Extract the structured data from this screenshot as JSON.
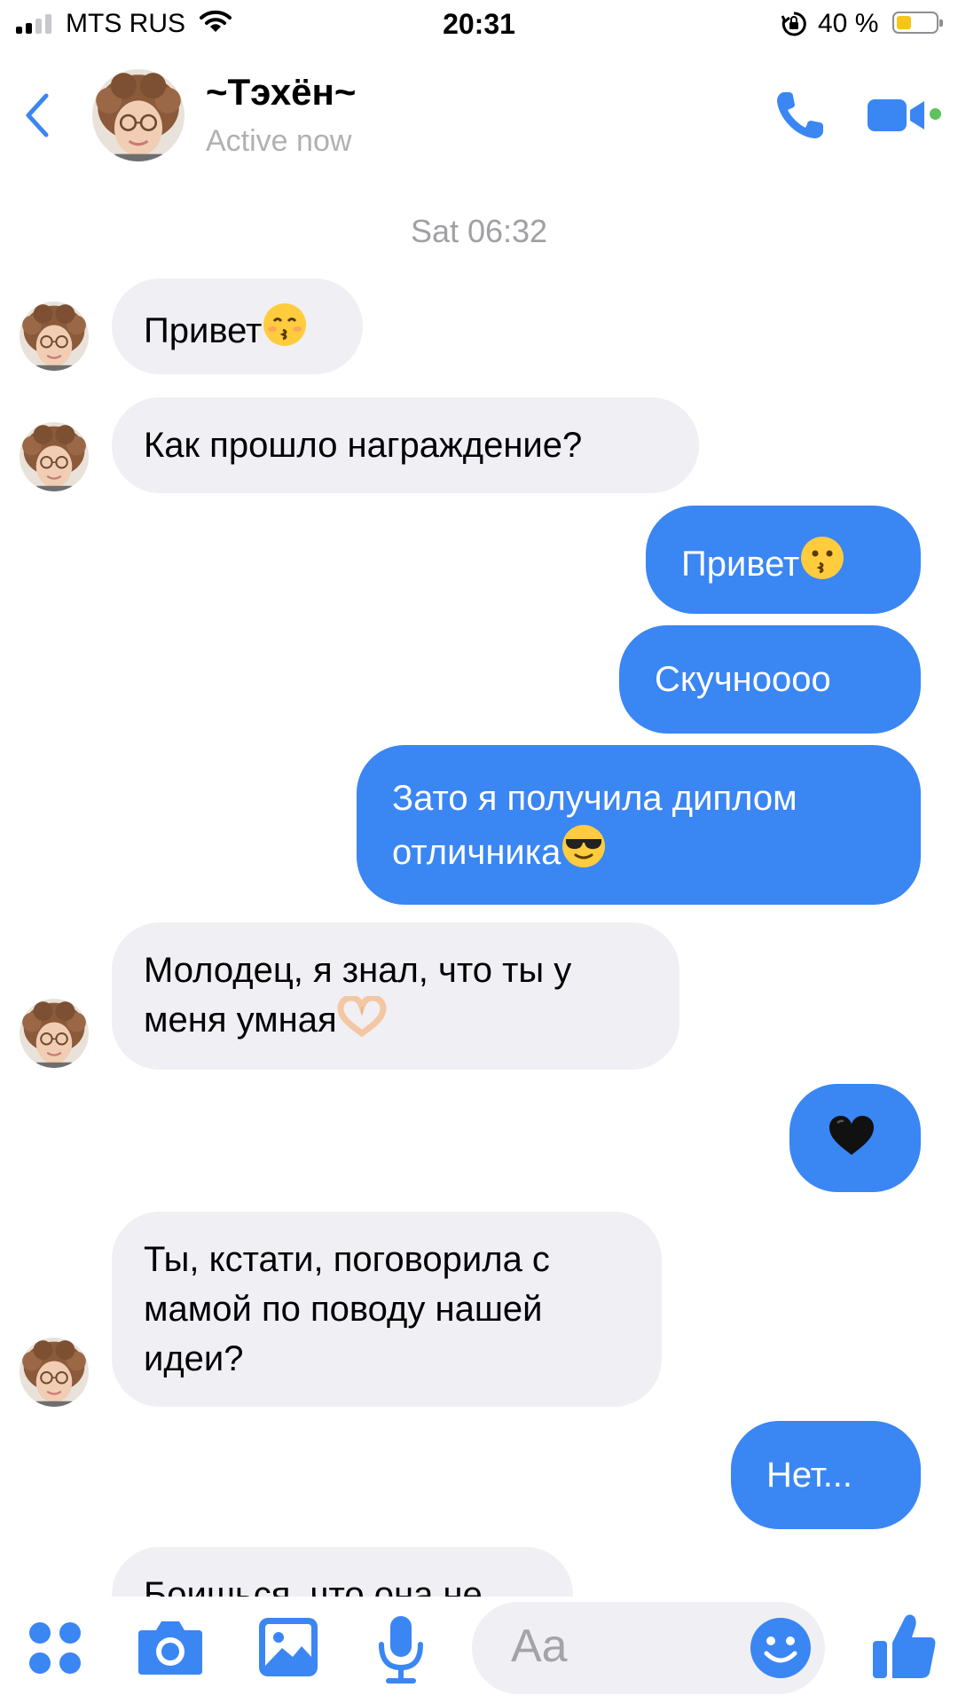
{
  "status_bar": {
    "carrier": "MTS RUS",
    "time": "20:31",
    "battery": "40 %"
  },
  "header": {
    "name": "~Тэхён~",
    "status": "Active now"
  },
  "timestamp": "Sat 06:32",
  "messages": [
    {
      "dir": "in",
      "text": "Привет",
      "emoji": "kissing-smiling-eyes"
    },
    {
      "dir": "in",
      "text": "Как прошло награждение?"
    },
    {
      "dir": "out",
      "text": "Привет",
      "emoji": "kissing-face"
    },
    {
      "dir": "out",
      "text": "Скучноооо"
    },
    {
      "dir": "out",
      "text": "Зато я получила диплом отличника",
      "emoji": "sunglasses-face"
    },
    {
      "dir": "in",
      "text": "Молодец, я знал, что ты у меня умная",
      "emoji": "heart-hands"
    },
    {
      "dir": "out",
      "text": "",
      "emoji": "black-heart"
    },
    {
      "dir": "in",
      "text": "Ты, кстати, поговорила с мамой по поводу нашей идеи?"
    },
    {
      "dir": "out",
      "text": "Нет..."
    },
    {
      "dir": "in",
      "text": "Боишься, что она не"
    }
  ],
  "composer": {
    "placeholder": "Aa"
  },
  "colors": {
    "accent": "#3a86f3",
    "incoming_bubble": "#f0eff4",
    "online": "#5cc35c"
  }
}
